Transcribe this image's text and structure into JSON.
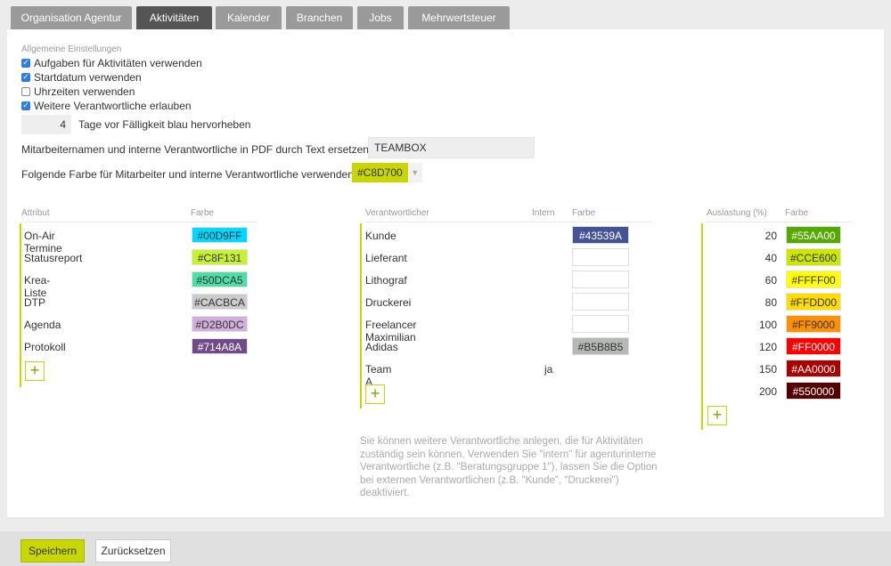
{
  "tabs": [
    {
      "label": "Organisation Agentur",
      "active": false
    },
    {
      "label": "Aktivitäten",
      "active": true
    },
    {
      "label": "Kalender",
      "active": false
    },
    {
      "label": "Branchen",
      "active": false
    },
    {
      "label": "Jobs",
      "active": false
    },
    {
      "label": "Mehrwertsteuer",
      "active": false
    }
  ],
  "general": {
    "heading": "Allgemeine Einstellungen",
    "options": [
      {
        "label": "Aufgaben für Aktivitäten verwenden",
        "checked": true
      },
      {
        "label": "Startdatum verwenden",
        "checked": true
      },
      {
        "label": "Uhrzeiten verwenden",
        "checked": false
      },
      {
        "label": "Weitere Verantwortliche erlauben",
        "checked": true
      }
    ],
    "days_value": "4",
    "days_label": "Tage vor Fälligkeit blau hervorheben",
    "pdf_label": "Mitarbeiternamen und interne Verantwortliche in PDF durch Text ersetzen",
    "pdf_value": "TEAMBOX",
    "color_label": "Folgende Farbe für Mitarbeiter und interne Verantwortliche verwenden",
    "color_value": "#C8D700"
  },
  "attributes": {
    "col_name": "Attribut",
    "col_color": "Farbe",
    "rows": [
      {
        "name": "On-Air Termine",
        "color": "#00D9FF"
      },
      {
        "name": "Statusreport",
        "color": "#C8F131"
      },
      {
        "name": "Krea-Liste",
        "color": "#50DCA5"
      },
      {
        "name": "DTP",
        "color": "#CACBCA"
      },
      {
        "name": "Agenda",
        "color": "#D2B0DC"
      },
      {
        "name": "Protokoll",
        "color": "#714A8A"
      }
    ],
    "add_label": "+"
  },
  "responsibles": {
    "col_name": "Verantwortlicher",
    "col_intern": "Intern",
    "col_color": "Farbe",
    "rows": [
      {
        "name": "Kunde",
        "intern": "",
        "color": "#43539A"
      },
      {
        "name": "Lieferant",
        "intern": "",
        "color": ""
      },
      {
        "name": "Lithograf",
        "intern": "",
        "color": ""
      },
      {
        "name": "Druckerei",
        "intern": "",
        "color": ""
      },
      {
        "name": "Freelancer Maximilian",
        "intern": "",
        "color": ""
      },
      {
        "name": "Adidas",
        "intern": "",
        "color": "#B5B8B5"
      },
      {
        "name": "Team A",
        "intern": "ja",
        "color": null
      }
    ],
    "add_label": "+",
    "hint": [
      "Sie können weitere Verantwortliche anlegen, die für Aktivitäten",
      "zuständig sein können. Verwenden Sie \"intern\" für agenturinterne",
      "Verantwortliche (z.B. \"Beratungsgruppe 1\"), lassen Sie die Option",
      "bei externen Verantwortlichen (z.B. \"Kunde\", \"Druckerei\")",
      "deaktiviert."
    ]
  },
  "utilization": {
    "col_value": "Auslastung (%)",
    "col_color": "Farbe",
    "rows": [
      {
        "value": "20",
        "color": "#55AA00"
      },
      {
        "value": "40",
        "color": "#CCE600"
      },
      {
        "value": "60",
        "color": "#FFFF00"
      },
      {
        "value": "80",
        "color": "#FFDD00"
      },
      {
        "value": "100",
        "color": "#FF9000"
      },
      {
        "value": "120",
        "color": "#FF0000"
      },
      {
        "value": "150",
        "color": "#AA0000"
      },
      {
        "value": "200",
        "color": "#550000"
      }
    ],
    "add_label": "+"
  },
  "footer": {
    "save_label": "Speichern",
    "reset_label": "Zurücksetzen"
  }
}
